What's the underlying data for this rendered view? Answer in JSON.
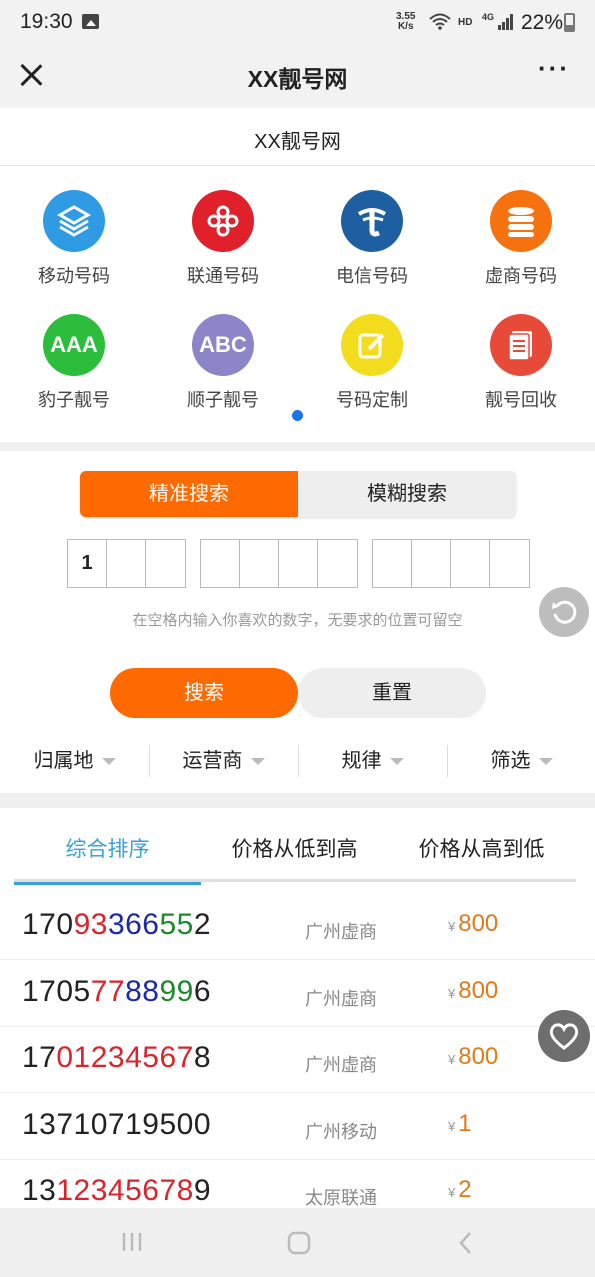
{
  "status_bar": {
    "time": "19:30",
    "net_speed_value": "3.55",
    "net_speed_unit": "K/s",
    "hd": "HD",
    "net_type": "4G",
    "battery": "22%"
  },
  "title_bar": {
    "title": "XX靓号网"
  },
  "page_header": {
    "title": "XX靓号网"
  },
  "categories": [
    {
      "label": "移动号码",
      "icon": "china-mobile-icon",
      "color": "#2f9be4",
      "glyph": "≋"
    },
    {
      "label": "联通号码",
      "icon": "china-unicom-icon",
      "color": "#e0202a",
      "glyph": "✣"
    },
    {
      "label": "电信号码",
      "icon": "china-telecom-icon",
      "color": "#1d5fa0",
      "glyph": "ℯ"
    },
    {
      "label": "虚商号码",
      "icon": "coins-stack-icon",
      "color": "#f5720f",
      "glyph": "☰"
    },
    {
      "label": "豹子靓号",
      "icon": "aaa-icon",
      "color": "#2bbd3b",
      "glyph": "AAA"
    },
    {
      "label": "顺子靓号",
      "icon": "abc-icon",
      "color": "#8c85c8",
      "glyph": "ABC"
    },
    {
      "label": "号码定制",
      "icon": "edit-icon",
      "color": "#f3dc1e",
      "glyph": "✎"
    },
    {
      "label": "靓号回收",
      "icon": "document-icon",
      "color": "#e84a3a",
      "glyph": "▤"
    }
  ],
  "search": {
    "tab_exact": "精准搜索",
    "tab_fuzzy": "模糊搜索",
    "digits_group1": [
      "1",
      "",
      ""
    ],
    "digits_group2": [
      "",
      "",
      "",
      ""
    ],
    "digits_group3": [
      "",
      "",
      "",
      ""
    ],
    "hint": "在空格内输入你喜欢的数字，无要求的位置可留空",
    "search_button": "搜索",
    "reset_button": "重置"
  },
  "filters": [
    "归属地",
    "运营商",
    "规律",
    "筛选"
  ],
  "sort_tabs": [
    "综合排序",
    "价格从低到高",
    "价格从高到低"
  ],
  "colors": {
    "accent": "#ff6a00",
    "tab_active": "#3aa0d8",
    "price": "#e07a1a"
  },
  "currency_symbol": "¥",
  "listings": [
    {
      "number": "17093366552",
      "segments": [
        [
          "170",
          "k"
        ],
        [
          "93",
          "r"
        ],
        [
          "366",
          "bl"
        ],
        [
          "55",
          "g"
        ],
        [
          "2",
          "k"
        ]
      ],
      "location": "广州虚商",
      "price": "800"
    },
    {
      "number": "17057788996",
      "segments": [
        [
          "1705",
          "k"
        ],
        [
          "77",
          "r"
        ],
        [
          "88",
          "bl"
        ],
        [
          "99",
          "g"
        ],
        [
          "6",
          "k"
        ]
      ],
      "location": "广州虚商",
      "price": "800"
    },
    {
      "number": "17012345678",
      "segments": [
        [
          "17",
          "k"
        ],
        [
          "0123456",
          "r"
        ],
        [
          "7",
          "r"
        ],
        [
          "8",
          "k"
        ]
      ],
      "location": "广州虚商",
      "price": "800"
    },
    {
      "number": "13710719500",
      "segments": [
        [
          "13710719500",
          "k"
        ]
      ],
      "location": "广州移动",
      "price": "1"
    },
    {
      "number": "13123456789",
      "segments": [
        [
          "13",
          "k"
        ],
        [
          "1234567",
          "r"
        ],
        [
          "8",
          "r"
        ],
        [
          "9",
          "k"
        ]
      ],
      "location": "太原联通",
      "price": "2"
    }
  ]
}
